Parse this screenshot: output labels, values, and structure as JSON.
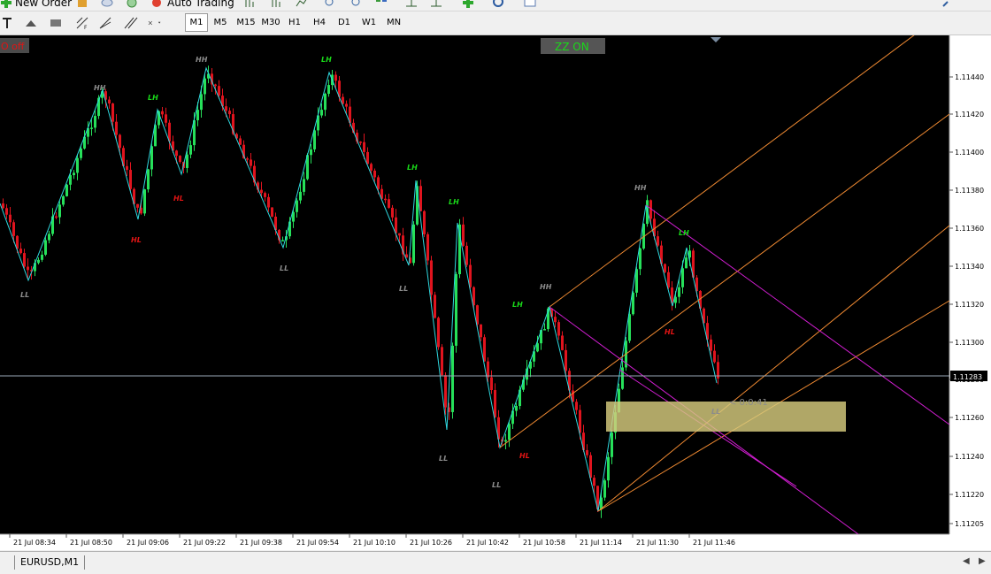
{
  "toolbar": {
    "new_order_label": "New Order",
    "auto_trading_label": "Auto Trading",
    "timeframes": [
      "M1",
      "M5",
      "M15",
      "M30",
      "H1",
      "H4",
      "D1",
      "W1",
      "MN"
    ],
    "active_timeframe": "M1"
  },
  "chart": {
    "bg_color": "#000000",
    "up_color": "#26e05a",
    "down_color": "#e0141e",
    "zigzag_color": "#2fd9e0",
    "hl_color": "#9ab8ff",
    "price_axis_labels": [
      "1.11440",
      "1.11420",
      "1.11400",
      "1.11380",
      "1.11360",
      "1.11340",
      "1.11320",
      "1.11300",
      "1.11280",
      "1.11260",
      "1.11240",
      "1.11220",
      "1.11205"
    ],
    "current_price": "1.11283",
    "time_labels": [
      "21 Jul 08:34",
      "21 Jul 08:50",
      "21 Jul 09:06",
      "21 Jul 09:22",
      "21 Jul 09:38",
      "21 Jul 09:54",
      "21 Jul 10:10",
      "21 Jul 10:26",
      "21 Jul 10:42",
      "21 Jul 10:58",
      "21 Jul 11:14",
      "21 Jul 11:30",
      "21 Jul 11:46"
    ],
    "left_button": "O off",
    "zz_button": "ZZ ON",
    "countdown": "< 0:0:41",
    "zigzag_labels": [
      {
        "text": "HH",
        "kind": "hh"
      },
      {
        "text": "LH",
        "kind": "lh"
      },
      {
        "text": "HH",
        "kind": "hh"
      },
      {
        "text": "LH",
        "kind": "lh"
      },
      {
        "text": "LL",
        "kind": "ll"
      },
      {
        "text": "HL",
        "kind": "hl"
      },
      {
        "text": "HL",
        "kind": "hl"
      },
      {
        "text": "LL",
        "kind": "ll"
      },
      {
        "text": "LH",
        "kind": "lh"
      },
      {
        "text": "LL",
        "kind": "ll"
      },
      {
        "text": "LH",
        "kind": "lh"
      },
      {
        "text": "LL",
        "kind": "ll"
      },
      {
        "text": "LL",
        "kind": "ll"
      },
      {
        "text": "HL",
        "kind": "hl"
      },
      {
        "text": "LH",
        "kind": "lh"
      },
      {
        "text": "HH",
        "kind": "hh"
      },
      {
        "text": "HH",
        "kind": "hh"
      },
      {
        "text": "LH",
        "kind": "lh"
      },
      {
        "text": "HL",
        "kind": "hl"
      },
      {
        "text": "LL",
        "kind": "ll"
      }
    ],
    "label_colors": {
      "hh": "#8c8c8c",
      "ll": "#8c8c8c",
      "lh": "#19d919",
      "hl": "#e01414"
    }
  },
  "tabbar": {
    "tab_label": "EURUSD,M1"
  }
}
